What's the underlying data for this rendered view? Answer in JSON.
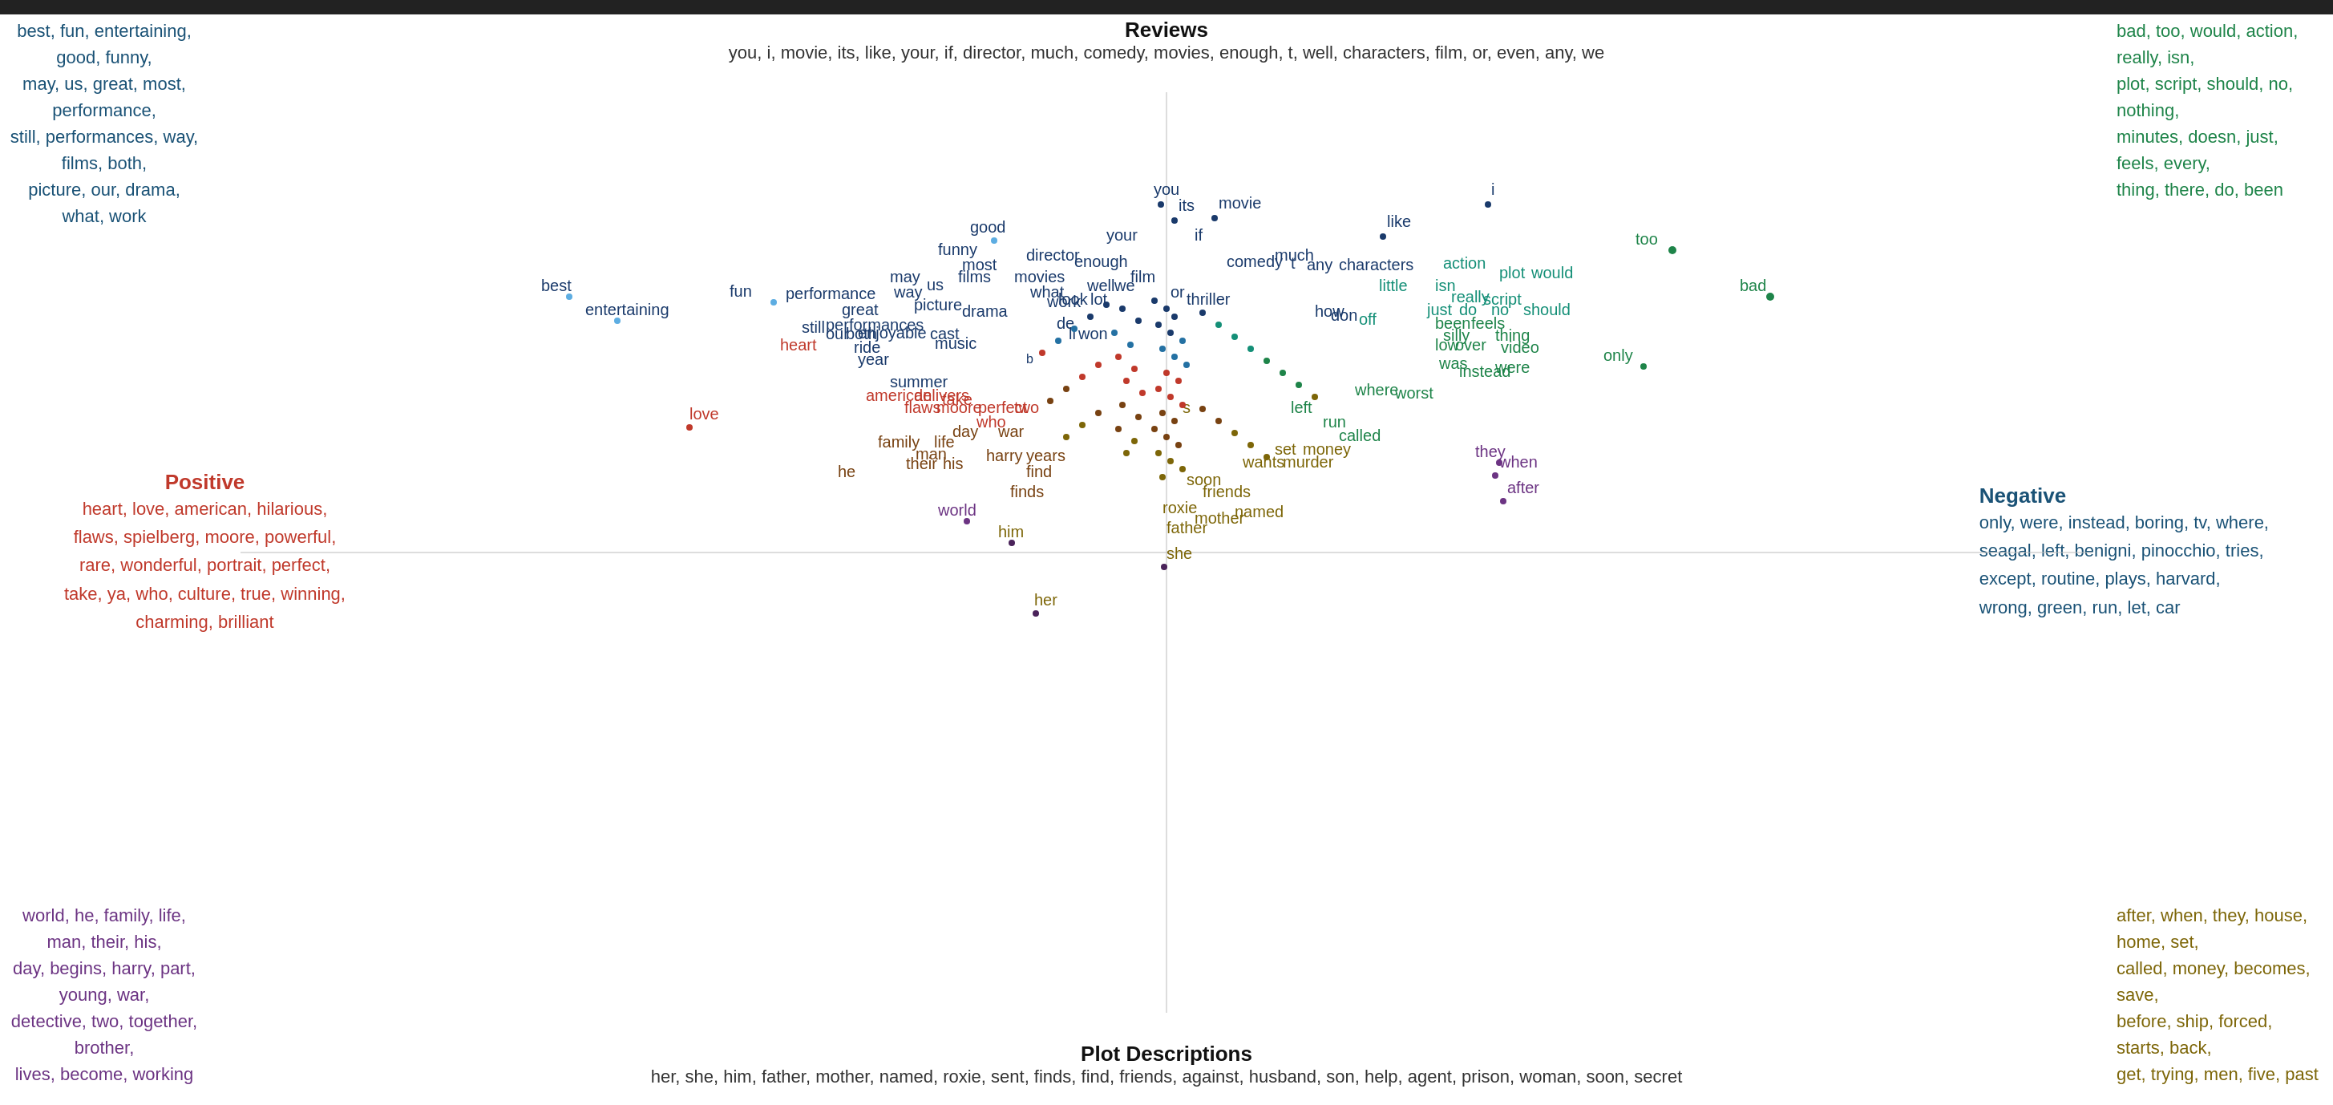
{
  "top_bar": {
    "color": "#222"
  },
  "corners": {
    "top_left": "best, fun, entertaining, good, funny,\nmay, us, great, most, performance,\nstill, performances, way, films, both,\npicture, our, drama, what, work",
    "top_right": "bad, too, would, action, really, isn,\nplot, script, should, no, nothing,\nminutes, doesn, just, feels, every,\nthing, there, do, been",
    "bottom_left": "world, he, family, life, man, their, his,\nday, begins, harry, part, young, war,\ndetective, two, together, brother,\nlives, become, working",
    "bottom_right": "after, when, they, house, home, set,\ncalled, money, becomes, save,\nbefore, ship, forced, starts, back,\nget, trying, men, five, past"
  },
  "axes": {
    "top_title": "Reviews",
    "top_words": "you, i, movie, its, like, your, if, director, much, comedy, movies, enough, t, well, characters, film, or, even, any, we",
    "bottom_title": "Plot Descriptions",
    "bottom_words": "her, she, him, father, mother, named, roxie, sent, finds, find, friends, against, husband, son, help, agent, prison, woman, soon, secret",
    "left_title": "Positive",
    "left_words": "heart, love, american, hilarious,\nflaws, spielberg, moore, powerful,\nrare, wonderful, portrait, perfect,\ntake, ya, who, culture, true, winning,\ncharming, brilliant",
    "right_title": "Negative",
    "right_words": "only, were, instead, boring, tv, where,\nseagal, left, benigni, pinocchio, tries,\nexcept, routine, plays, harvard,\nwrong, green, run, let, car"
  }
}
